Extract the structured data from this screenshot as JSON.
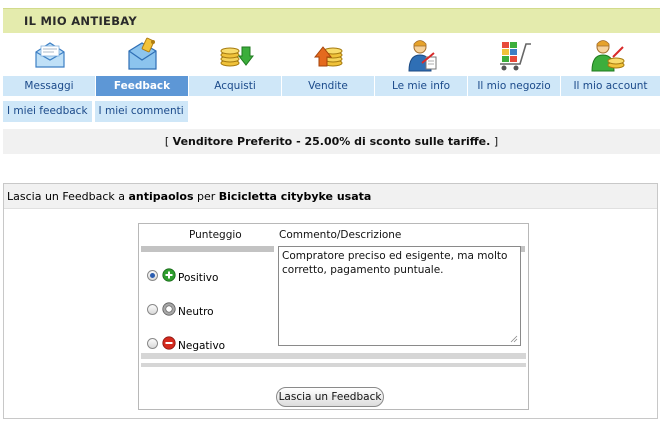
{
  "header": {
    "title": "IL MIO ANTIEBAY"
  },
  "nav_icons": [
    "messages-icon",
    "feedback-icon",
    "purchases-icon",
    "sales-icon",
    "my-info-icon",
    "my-shop-icon",
    "my-account-icon"
  ],
  "tabs": [
    {
      "label": "Messaggi",
      "active": false
    },
    {
      "label": "Feedback",
      "active": true
    },
    {
      "label": "Acquisti",
      "active": false
    },
    {
      "label": "Vendite",
      "active": false
    },
    {
      "label": "Le mie info",
      "active": false
    },
    {
      "label": "Il mio negozio",
      "active": false
    },
    {
      "label": "Il mio account",
      "active": false
    }
  ],
  "subtabs": [
    {
      "label": "I miei feedback"
    },
    {
      "label": "I miei commenti"
    }
  ],
  "promo": {
    "open": "[ ",
    "bold": "Venditore Preferito - 25.00% di sconto sulle tariffe.",
    "close": " ]"
  },
  "panel": {
    "prefix": "Lascia un Feedback a ",
    "user": "antipaolos",
    "mid": " per ",
    "item": "Bicicletta citybyke usata"
  },
  "form": {
    "col_score": "Punteggio",
    "col_comment": "Commento/Descrizione",
    "options": [
      {
        "label": "Positivo",
        "selected": true,
        "icon": "positive-icon",
        "color": "#2e9e2e"
      },
      {
        "label": "Neutro",
        "selected": false,
        "icon": "neutral-icon",
        "color": "#9a9a9a"
      },
      {
        "label": "Negativo",
        "selected": false,
        "icon": "negative-icon",
        "color": "#d42a1e"
      }
    ],
    "comment_value": "Compratore preciso ed esigente, ma molto corretto, pagamento puntuale.",
    "submit_label": "Lascia un Feedback"
  },
  "colors": {
    "header_bg": "#e4ebad",
    "tab_bg": "#cfe7f8",
    "tab_active_bg": "#5d97d6",
    "tab_text": "#1b4a8a"
  }
}
